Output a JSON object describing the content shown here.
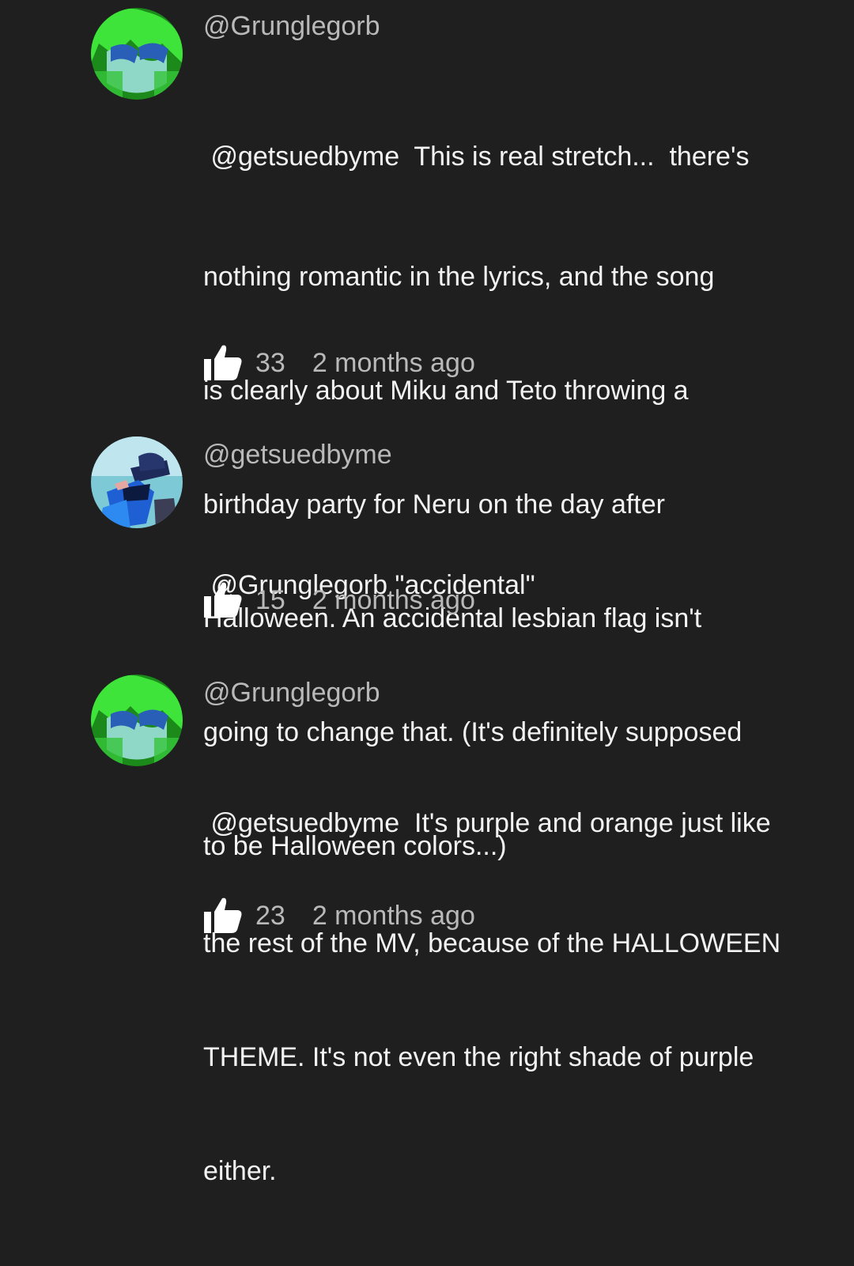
{
  "comments": [
    {
      "author": "@Grunglegorb",
      "avatar_icon": "green-hair-avatar-icon",
      "lines": [
        " @getsuedbyme  This is real stretch...  there's",
        "nothing romantic in the lyrics, and the song",
        "is clearly about Miku and Teto throwing a",
        "birthday party for Neru on the day after",
        "Halloween. An accidental lesbian flag isn't",
        "going to change that. (It's definitely supposed",
        "to be Halloween colors...)"
      ],
      "likes": "33",
      "timestamp": "2 months ago"
    },
    {
      "author": "@getsuedbyme",
      "avatar_icon": "blue-hat-avatar-icon",
      "lines": [
        " @Grunglegorb \"accidental\""
      ],
      "likes": "15",
      "timestamp": "2 months ago"
    },
    {
      "author": "@Grunglegorb",
      "avatar_icon": "green-hair-avatar-icon",
      "lines": [
        " @getsuedbyme  It's purple and orange just like",
        "the rest of the MV, because of the HALLOWEEN",
        "THEME. It's not even the right shade of purple",
        "either."
      ],
      "likes": "23",
      "timestamp": "2 months ago"
    }
  ],
  "colors": {
    "background": "#1f1f1f",
    "text": "#f3f3f3",
    "secondary_text": "#b9b9b9",
    "like_icon": "#ffffff"
  }
}
